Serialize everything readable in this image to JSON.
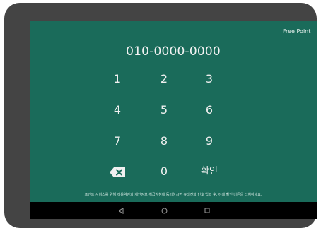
{
  "screen": {
    "free_point_label": "Free Point",
    "phone_number": "010-0000-0000"
  },
  "keypad": {
    "keys": [
      "1",
      "2",
      "3",
      "4",
      "5",
      "6",
      "7",
      "8",
      "9",
      "0"
    ],
    "confirm_label": "확인",
    "backspace_icon": "backspace-icon"
  },
  "notice": {
    "text": "포인트 서비스를 위해 이용약관과 개인정보 취급방침에 동의하시면 휴대전화 번호 입력 후, 아래 확인 버튼을 터치하세요."
  },
  "navbar": {
    "icons": [
      "back-icon",
      "home-icon",
      "recents-icon"
    ]
  },
  "colors": {
    "screen_bg": "#1a6b5a",
    "bezel": "#444444",
    "navbar": "#000000"
  }
}
